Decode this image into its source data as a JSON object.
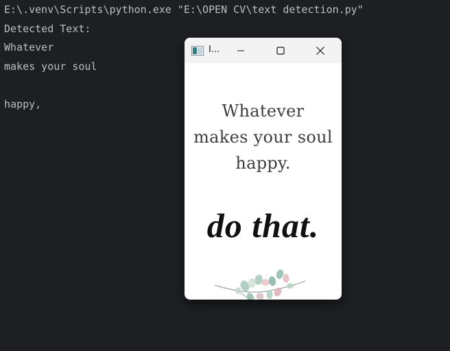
{
  "console": {
    "lines": [
      "E:\\.venv\\Scripts\\python.exe \"E:\\OPEN CV\\text detection.py\"",
      "Detected Text:",
      "Whatever",
      "makes your soul",
      "",
      "happy,"
    ]
  },
  "image_window": {
    "title": "I...",
    "quote": [
      "Whatever",
      "makes your soul",
      "happy."
    ],
    "script_text": "do that."
  }
}
